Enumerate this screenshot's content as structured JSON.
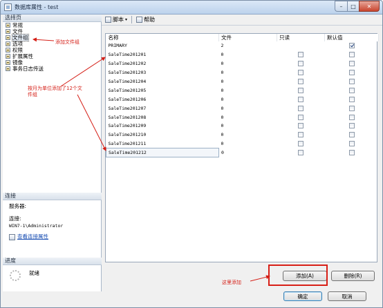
{
  "window": {
    "title": "数据库属性 - test",
    "close_glyph": "✕",
    "min_glyph": "–",
    "max_glyph": "□"
  },
  "left": {
    "select_page_header": "选择页",
    "pages": [
      {
        "label": "常规",
        "icon": "page-icon"
      },
      {
        "label": "文件",
        "icon": "page-icon"
      },
      {
        "label": "文件组",
        "icon": "page-icon",
        "selected": true
      },
      {
        "label": "选项",
        "icon": "page-icon"
      },
      {
        "label": "权限",
        "icon": "page-icon"
      },
      {
        "label": "扩展属性",
        "icon": "page-icon"
      },
      {
        "label": "镜像",
        "icon": "page-icon"
      },
      {
        "label": "事务日志传送",
        "icon": "page-icon"
      }
    ],
    "connection_header": "连接",
    "server_label": "服务器:",
    "server_value": "",
    "connection_label": "连接:",
    "connection_value": "WIN7-1\\Administrator",
    "view_conn_link": "查看连接属性",
    "progress_header": "进度",
    "progress_status": "就绪"
  },
  "toolbar": {
    "script_label": "脚本",
    "help_label": "帮助"
  },
  "grid": {
    "columns": [
      "名称",
      "文件",
      "只读",
      "默认值"
    ],
    "rows": [
      {
        "name": "PRIMARY",
        "files": "2",
        "readonly": null,
        "default": true
      },
      {
        "name": "SaleTime201201",
        "files": "0",
        "readonly": false,
        "default": false
      },
      {
        "name": "SaleTime201202",
        "files": "0",
        "readonly": false,
        "default": false
      },
      {
        "name": "SaleTime201203",
        "files": "0",
        "readonly": false,
        "default": false
      },
      {
        "name": "SaleTime201204",
        "files": "0",
        "readonly": false,
        "default": false
      },
      {
        "name": "SaleTime201205",
        "files": "0",
        "readonly": false,
        "default": false
      },
      {
        "name": "SaleTime201206",
        "files": "0",
        "readonly": false,
        "default": false
      },
      {
        "name": "SaleTime201207",
        "files": "0",
        "readonly": false,
        "default": false
      },
      {
        "name": "SaleTime201208",
        "files": "0",
        "readonly": false,
        "default": false
      },
      {
        "name": "SaleTime201209",
        "files": "0",
        "readonly": false,
        "default": false
      },
      {
        "name": "SaleTime201210",
        "files": "0",
        "readonly": false,
        "default": false
      },
      {
        "name": "SaleTime201211",
        "files": "0",
        "readonly": false,
        "default": false
      },
      {
        "name": "SaleTime201212",
        "files": "0",
        "readonly": false,
        "default": false,
        "selected": true
      }
    ]
  },
  "buttons": {
    "add": "添加(A)",
    "remove": "删除(R)",
    "ok": "确定",
    "cancel": "取消"
  },
  "annotations": {
    "add_filegroup": "添加文件组",
    "monthly_note": "按月为单位添加了12个文件组",
    "add_here": "这里添加",
    "color": "#d51e16"
  }
}
